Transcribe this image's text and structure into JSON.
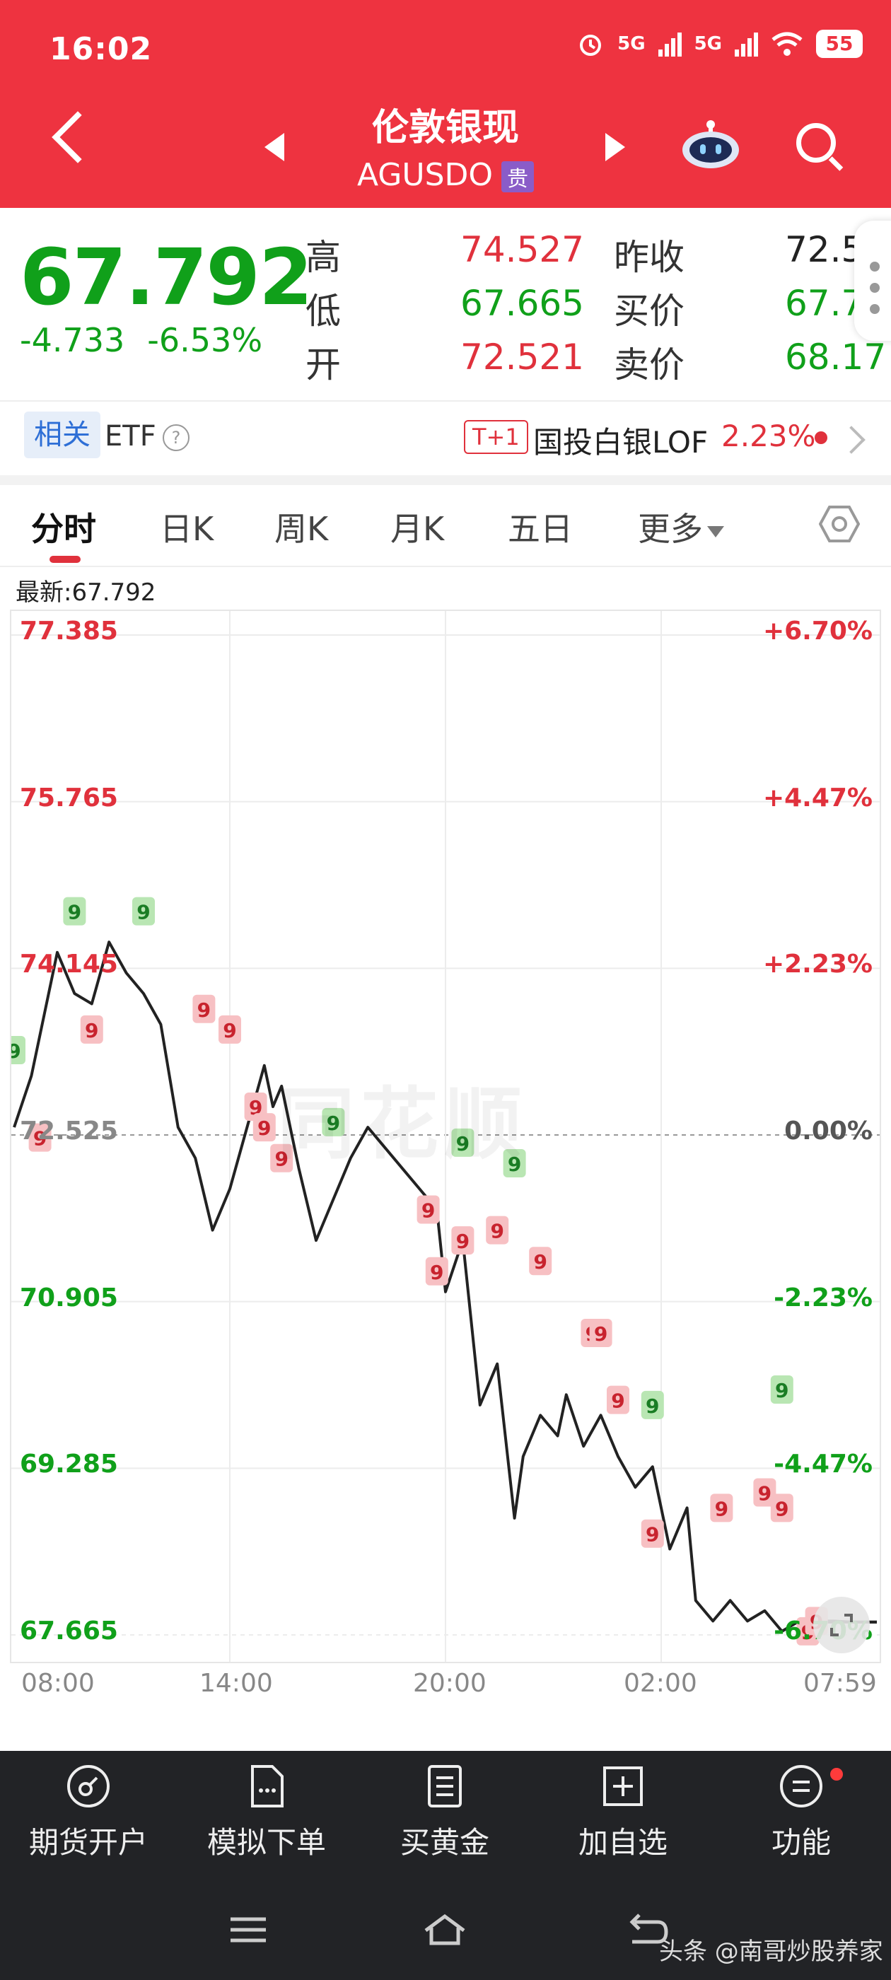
{
  "status_bar": {
    "time": "16:02",
    "net1": "5G",
    "net2": "5G",
    "battery": "55"
  },
  "header": {
    "title": "伦敦银现",
    "symbol": "AGUSDO",
    "badge": "贵"
  },
  "quote": {
    "price": "67.792",
    "change": "-4.733",
    "change_pct": "-6.53%",
    "labels": {
      "high": "高",
      "low": "低",
      "open": "开",
      "prev_close": "昨收",
      "bid": "买价",
      "ask": "卖价"
    },
    "values": {
      "high": "74.527",
      "low": "67.665",
      "open": "72.521",
      "prev_close": "72.5",
      "bid": "67.7",
      "ask": "68.17"
    }
  },
  "etf": {
    "tag": "相关",
    "label": "ETF",
    "help": "?",
    "badge": "T+1",
    "name": "国投白银LOF",
    "pct": "2.23%"
  },
  "tabs": [
    "分时",
    "日K",
    "周K",
    "月K",
    "五日",
    "更多"
  ],
  "latest_text": "最新:67.792",
  "watermark": "同花顺",
  "chart_data": {
    "type": "line",
    "y_left_ticks": [
      "77.385",
      "75.765",
      "74.145",
      "72.525",
      "70.905",
      "69.285",
      "67.665"
    ],
    "y_right_ticks": [
      "+6.70%",
      "+4.47%",
      "+2.23%",
      "0.00%",
      "-2.23%",
      "-4.47%",
      "-6.70%"
    ],
    "x_ticks": [
      "08:00",
      "14:00",
      "20:00",
      "02:00",
      "07:59"
    ],
    "ylim": [
      67.665,
      77.385
    ],
    "baseline": 72.525,
    "series": [
      {
        "x": [
          0,
          0.02,
          0.035,
          0.05,
          0.07,
          0.09,
          0.11,
          0.13,
          0.15,
          0.17,
          0.19,
          0.21,
          0.23,
          0.25,
          0.27,
          0.29,
          0.3,
          0.31,
          0.33,
          0.35,
          0.37,
          0.39,
          0.41,
          0.43,
          0.45,
          0.47,
          0.49,
          0.5,
          0.52,
          0.54,
          0.56,
          0.58,
          0.59,
          0.61,
          0.63,
          0.64,
          0.66,
          0.68,
          0.7,
          0.72,
          0.74,
          0.76,
          0.78,
          0.79,
          0.81,
          0.83,
          0.85,
          0.87,
          0.89,
          0.91,
          0.93,
          0.95,
          0.97,
          1.0
        ],
        "values": [
          72.6,
          73.1,
          73.7,
          74.3,
          73.9,
          73.8,
          74.4,
          74.1,
          73.9,
          73.6,
          72.6,
          72.3,
          71.6,
          72.0,
          72.6,
          73.2,
          72.8,
          73.0,
          72.2,
          71.5,
          71.9,
          72.3,
          72.6,
          72.4,
          72.2,
          72.0,
          71.8,
          71.0,
          71.5,
          69.9,
          70.3,
          68.8,
          69.4,
          69.8,
          69.6,
          70.0,
          69.5,
          69.8,
          69.4,
          69.1,
          69.3,
          68.5,
          68.9,
          68.0,
          67.8,
          68.0,
          67.8,
          67.9,
          67.7,
          67.8,
          67.8,
          67.8,
          67.79,
          67.79
        ],
        "color": "#222222"
      }
    ],
    "markers_green": [
      [
        0.0,
        73.35
      ],
      [
        0.07,
        74.7
      ],
      [
        0.15,
        74.7
      ],
      [
        0.37,
        72.65
      ],
      [
        0.52,
        72.45
      ],
      [
        0.58,
        72.25
      ],
      [
        0.74,
        69.9
      ],
      [
        0.89,
        70.05
      ]
    ],
    "markers_red": [
      [
        0.03,
        72.5
      ],
      [
        0.09,
        73.55
      ],
      [
        0.22,
        73.75
      ],
      [
        0.25,
        73.55
      ],
      [
        0.28,
        72.8
      ],
      [
        0.29,
        72.6
      ],
      [
        0.31,
        72.3
      ],
      [
        0.48,
        71.8
      ],
      [
        0.49,
        71.2
      ],
      [
        0.52,
        71.5
      ],
      [
        0.56,
        71.6
      ],
      [
        0.61,
        71.3
      ],
      [
        0.67,
        70.6
      ],
      [
        0.68,
        70.6
      ],
      [
        0.7,
        69.95
      ],
      [
        0.74,
        68.65
      ],
      [
        0.82,
        68.9
      ],
      [
        0.87,
        69.05
      ],
      [
        0.89,
        68.9
      ],
      [
        0.92,
        67.7
      ],
      [
        0.93,
        67.8
      ]
    ]
  },
  "bottom_nav": [
    "期货开户",
    "模拟下单",
    "买黄金",
    "加自选",
    "功能"
  ],
  "credit": "头条 @南哥炒股养家",
  "colors": {
    "brand_red": "#ee3340",
    "up_red": "#e0313c",
    "down_green": "#10a01a",
    "nav_bg": "#222326"
  }
}
